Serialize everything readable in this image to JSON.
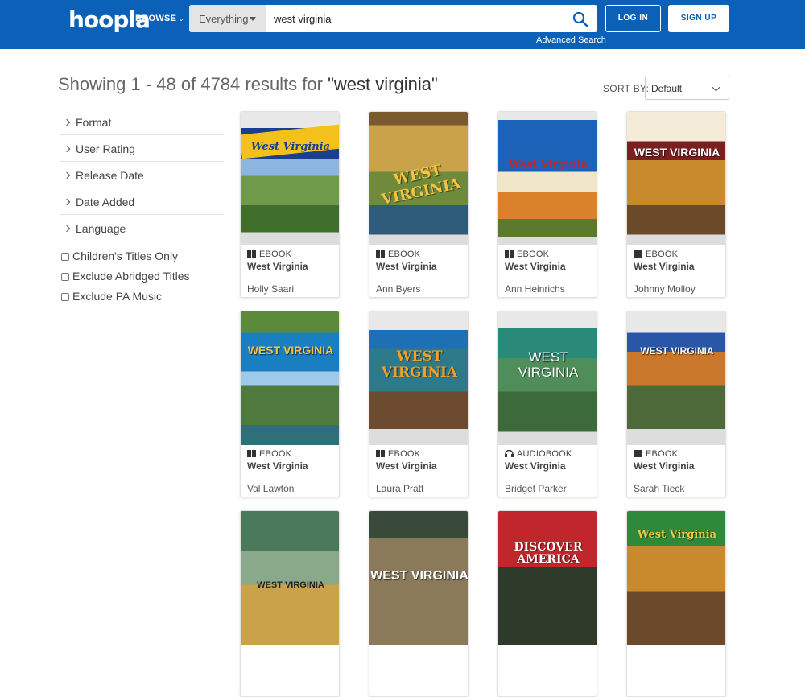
{
  "header": {
    "logo": "hoopla",
    "browse_label": "BROWSE",
    "search_scope": "Everything",
    "search_value": "west virginia",
    "advanced_search": "Advanced Search",
    "login_label": "LOG IN",
    "signup_label": "SIGN UP",
    "brand_color": "#0b61b8"
  },
  "results": {
    "prefix": "Showing 1 - 48 of 4784 results for",
    "query": "\"west virginia\"",
    "sort_label": "SORT BY:",
    "sort_value": "Default"
  },
  "filters": {
    "groups": [
      "Format",
      "User Rating",
      "Release Date",
      "Date Added",
      "Language"
    ],
    "checkboxes": [
      "Children's Titles Only",
      "Exclude Abridged Titles",
      "Exclude PA Music"
    ]
  },
  "cards": [
    {
      "format": "EBOOK",
      "title": "West Virginia",
      "author": "Holly Saari",
      "cover_text": "West Virginia"
    },
    {
      "format": "EBOOK",
      "title": "West Virginia",
      "author": "Ann Byers",
      "cover_text": "WEST VIRGINIA"
    },
    {
      "format": "EBOOK",
      "title": "West Virginia",
      "author": "Ann Heinrichs",
      "cover_text": "West Virginia"
    },
    {
      "format": "EBOOK",
      "title": "West Virginia",
      "author": "Johnny Molloy",
      "cover_text": "WEST VIRGINIA"
    },
    {
      "format": "EBOOK",
      "title": "West Virginia",
      "author": "Val Lawton",
      "cover_text": "WEST VIRGINIA"
    },
    {
      "format": "EBOOK",
      "title": "West Virginia",
      "author": "Laura Pratt",
      "cover_text": "WEST VIRGINIA"
    },
    {
      "format": "AUDIOBOOK",
      "title": "West Virginia",
      "author": "Bridget Parker",
      "cover_text": "WEST VIRGINIA"
    },
    {
      "format": "EBOOK",
      "title": "West Virginia",
      "author": "Sarah Tieck",
      "cover_text": "WEST VIRGINIA"
    },
    {
      "format": "",
      "title": "",
      "author": "",
      "cover_text": "WEST VIRGINIA"
    },
    {
      "format": "",
      "title": "",
      "author": "",
      "cover_text": "WEST VIRGINIA"
    },
    {
      "format": "",
      "title": "",
      "author": "",
      "cover_text": "DISCOVER AMERICA"
    },
    {
      "format": "",
      "title": "",
      "author": "",
      "cover_text": "West Virginia"
    }
  ]
}
